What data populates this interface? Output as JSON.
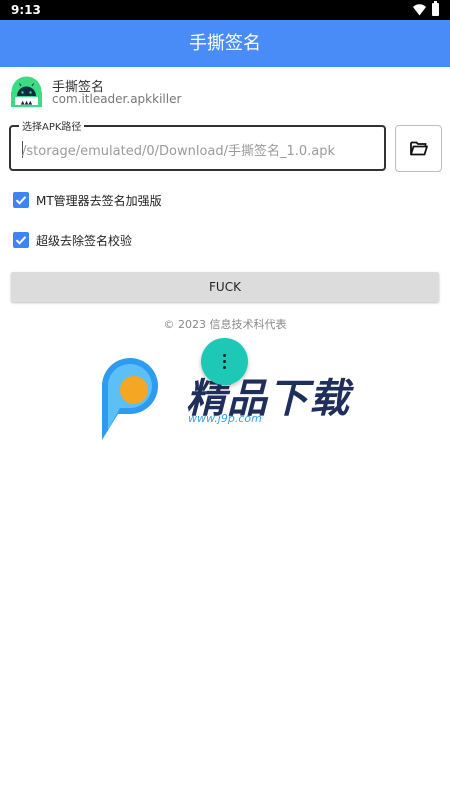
{
  "status_bar": {
    "time": "9:13"
  },
  "app_bar": {
    "title": "手撕签名"
  },
  "app_info": {
    "name": "手撕签名",
    "package": "com.itleader.apkkiller"
  },
  "apk_path": {
    "legend": "选择APK路径",
    "value": "/storage/emulated/0/Download/手撕签名_1.0.apk"
  },
  "options": [
    {
      "label": "MT管理器去签名加强版",
      "checked": true
    },
    {
      "label": "超级去除签名校验",
      "checked": true
    }
  ],
  "action_button": {
    "label": "FUCK"
  },
  "footer": {
    "copyright": "© 2023 信息技术科代表"
  },
  "watermark": {
    "title": "精品下载",
    "url": "www.j9p.com"
  },
  "colors": {
    "app_bar": "#4a8cf7",
    "checkbox": "#3f83f4",
    "fab": "#1ec8b7",
    "button": "#dcdcdc"
  },
  "icons": [
    "wifi-icon",
    "battery-icon",
    "android-app-icon",
    "folder-icon",
    "check-icon",
    "more-vert-icon"
  ]
}
